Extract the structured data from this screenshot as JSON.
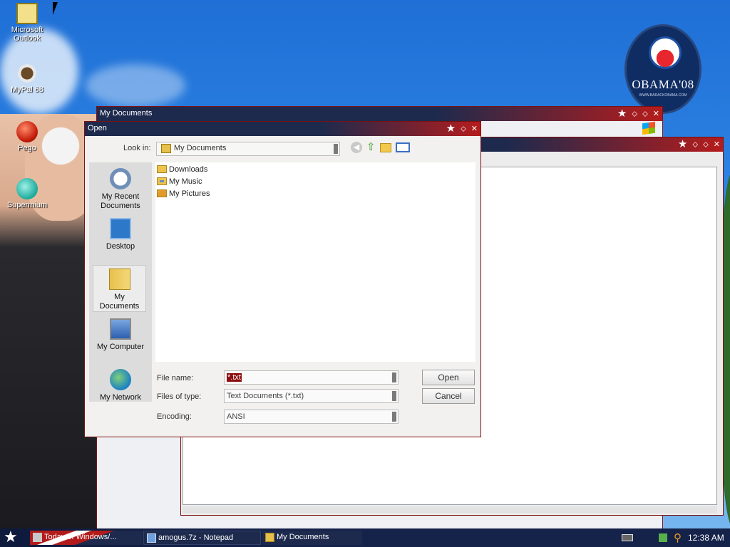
{
  "desktop": {
    "icons": [
      {
        "label": "Microsoft Outlook",
        "icon": "outlook-icon"
      },
      {
        "label": "MyPal 68",
        "icon": "mypal-icon"
      },
      {
        "label": "Pego",
        "icon": "pego-icon"
      },
      {
        "label": "Supermium",
        "icon": "supermium-icon"
      }
    ],
    "logo": {
      "text": "OBAMA'08",
      "small": "WWW.BARACKOBAMA.COM"
    }
  },
  "windows": {
    "mydocs": {
      "title": "My Documents"
    },
    "notepad": {
      "title": ""
    }
  },
  "dialog": {
    "title": "Open",
    "look_in_label": "Look in:",
    "look_in_value": "My Documents",
    "places": [
      {
        "label": "My Recent Documents",
        "icon": "recent-documents-icon"
      },
      {
        "label": "Desktop",
        "icon": "desktop-icon"
      },
      {
        "label": "My Documents",
        "icon": "my-documents-icon",
        "active": true
      },
      {
        "label": "My Computer",
        "icon": "my-computer-icon"
      },
      {
        "label": "My Network",
        "icon": "my-network-icon"
      }
    ],
    "files": [
      {
        "name": "Downloads",
        "icon": "folder-icon"
      },
      {
        "name": "My Music",
        "icon": "music-folder-icon"
      },
      {
        "name": "My Pictures",
        "icon": "pictures-folder-icon"
      }
    ],
    "file_name_label": "File name:",
    "file_name_value": "*.txt",
    "file_type_label": "Files of type:",
    "file_type_value": "Text Documents (*.txt)",
    "encoding_label": "Encoding:",
    "encoding_value": "ANSI",
    "open_label": "Open",
    "cancel_label": "Cancel"
  },
  "taskbar": {
    "tasks": [
      {
        "label": "Today of Windows/...",
        "icon": "flag-icon"
      },
      {
        "label": "amogus.7z - Notepad",
        "icon": "notepad-icon"
      },
      {
        "label": "My Documents",
        "icon": "folder-icon"
      }
    ],
    "clock": "12:38 AM"
  },
  "colors": {
    "title_dark": "#1d2a4d",
    "title_red": "#b51c1c",
    "selection": "#8b0d0d"
  }
}
